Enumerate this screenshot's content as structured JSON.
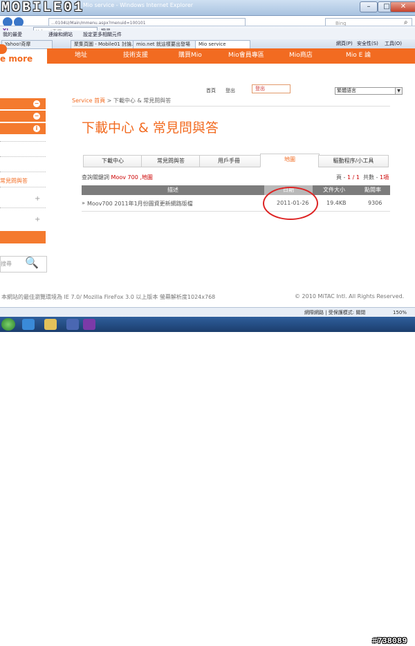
{
  "browser": {
    "title": "Mio service - Windows Internet Explorer",
    "watermark": "MOBILE01",
    "url": "...0104U/Main/mmenu.aspx?menuid=100101",
    "search_placeholder": "Bing",
    "yahoo_search_placeholder": "Yahoo!奇摩",
    "toolbar_items": [
      "搜尋",
      "連線和網站",
      "設定更多相關元件"
    ],
    "favorites": [
      "我的最愛",
      "Yahoo!奇摩"
    ],
    "tabs": [
      "聚集頁圖 - Mobile01 討論...",
      "mio.net 就這樣要出發場",
      "Mio service"
    ],
    "page_menu": "網頁(P)",
    "safety_menu": "安全性(S)",
    "tools_menu": "工具(O)"
  },
  "site": {
    "logo_text": "e more",
    "nav": [
      "地址",
      "技術支援",
      "購買Mio",
      "Mio會員專區",
      "Mio商店",
      "Mio E 論"
    ],
    "util": {
      "home": "首頁",
      "login": "登出",
      "logout": "登出",
      "lang": "繁體語言"
    },
    "breadcrumb": {
      "link": "Service 首頁",
      "rest": " > 下載中心 & 常見問與答"
    },
    "page_title": "下載中心 & 常見問與答",
    "sidebar_label": "常見問與答",
    "side_search_placeholder": "搜尋",
    "content_tabs": [
      "下載中心",
      "常見問與答",
      "用戶手冊",
      "地圖",
      "驅動程序/小工具"
    ],
    "query_prefix": "查詢關鍵詞",
    "query_value": "Moov 700 ,地圖",
    "page_prefix": "頁 - ",
    "page_value": "1 / 1",
    "count_prefix": "共數 - ",
    "count_value": "1項",
    "table": {
      "headers": [
        "描述",
        "日期",
        "文件大小",
        "點閱率"
      ],
      "row": {
        "desc": "Moov700 2011年1月份圖資更新網路版檔",
        "date": "2011-01-26",
        "size": "19.4KB",
        "views": "9306"
      }
    },
    "footer_left": "本網站的最佳瀏覽環境為 IE 7.0/ Mozilla FireFox 3.0 以上版本 螢幕解析度1024x768",
    "footer_right": "© 2010 MiTAC Intl. All Rights Reserved."
  },
  "status": {
    "text": "網際網路 | 受保護模式: 關閉",
    "zoom": "150%"
  },
  "taskbar": {
    "watermark": "#738089"
  }
}
